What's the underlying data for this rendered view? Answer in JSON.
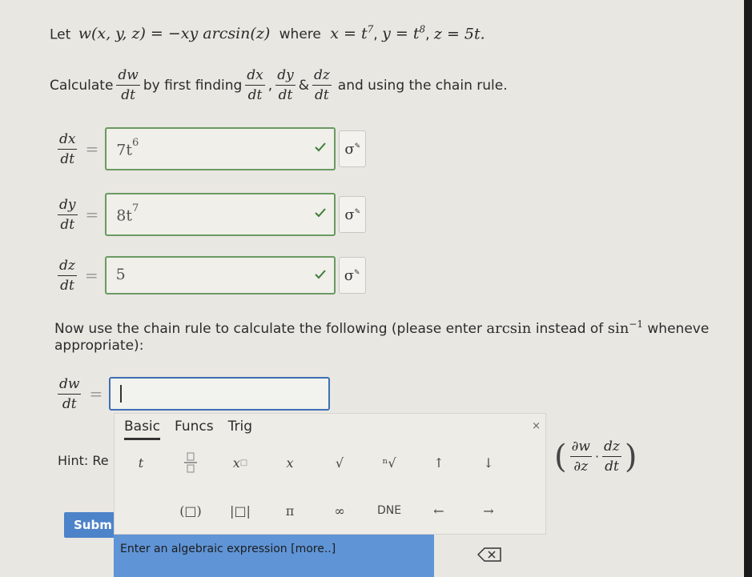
{
  "problem": {
    "let_prefix": "Let",
    "function_def": "w(x, y, z) = −xy arcsin(z)",
    "where_text": "where",
    "param_x": "x = t",
    "param_x_exp": "7",
    "param_y": "y = t",
    "param_y_exp": "8",
    "param_z": "z = 5t."
  },
  "instruction": {
    "calculate": "Calculate",
    "dw_num": "dw",
    "dw_den": "dt",
    "middle": "by first finding",
    "dx_num": "dx",
    "dx_den": "dt",
    "comma": ",",
    "dy_num": "dy",
    "dy_den": "dt",
    "amp": "&",
    "dz_num": "dz",
    "dz_den": "dt",
    "end": "and using the chain rule."
  },
  "answers": [
    {
      "num": "dx",
      "den": "dt",
      "eq": "=",
      "base": "7t",
      "exp": "6",
      "status": "correct"
    },
    {
      "num": "dy",
      "den": "dt",
      "eq": "=",
      "base": "8t",
      "exp": "7",
      "status": "correct"
    },
    {
      "num": "dz",
      "den": "dt",
      "eq": "=",
      "base": "5",
      "exp": "",
      "status": "correct"
    }
  ],
  "preview_icon": "sigma-preview-icon",
  "chain_prompt": {
    "part1": "Now use the chain rule to calculate the following (please enter",
    "arcsin": "arcsin",
    "part2": "instead of",
    "sin": "sin",
    "sin_exp": "−1",
    "part3": "wheneve",
    "line2": "appropriate):"
  },
  "final": {
    "num": "dw",
    "den": "dt",
    "eq": "=",
    "value": ""
  },
  "palette": {
    "tabs": [
      "Basic",
      "Funcs",
      "Trig"
    ],
    "active_tab": "Basic",
    "close": "×",
    "row1": [
      "t",
      "□/□",
      "x□",
      "x",
      "√",
      "ⁿ√",
      "↑",
      "↓"
    ],
    "row2": [
      "(□)",
      "|□|",
      "π",
      "∞",
      "DNE",
      "←",
      "→"
    ],
    "partial": {
      "num1": "∂w",
      "den1": "∂z",
      "dot": "·",
      "num2": "dz",
      "den2": "dt"
    },
    "expr_hint": "Enter an algebraic expression [more..]"
  },
  "hint": "Hint: Re",
  "submit_label": "Subm",
  "colors": {
    "correct_border": "#6a9a62",
    "active_border": "#3f6fb3",
    "expr_bar": "#5f94d6"
  }
}
